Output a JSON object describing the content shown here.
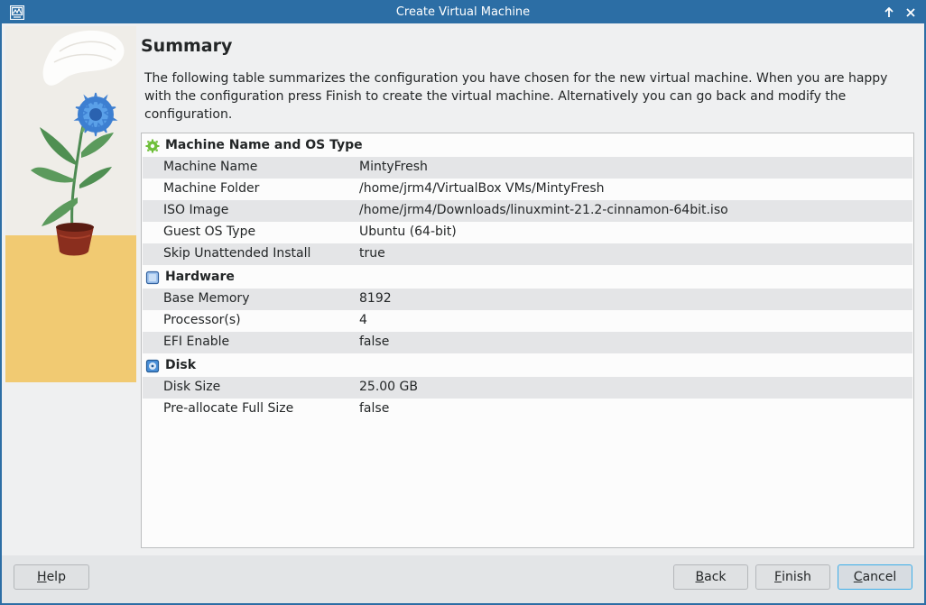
{
  "window": {
    "title": "Create Virtual Machine"
  },
  "page": {
    "heading": "Summary",
    "description": "The following table summarizes the configuration you have chosen for the new virtual machine. When you are happy with the configuration press Finish to create the virtual machine. Alternatively you can go back and modify the configuration."
  },
  "summary": {
    "groups": [
      {
        "title": "Machine Name and OS Type",
        "icon": "gear-cog-icon",
        "rows": [
          {
            "key": "Machine Name",
            "value": "MintyFresh"
          },
          {
            "key": "Machine Folder",
            "value": "/home/jrm4/VirtualBox VMs/MintyFresh"
          },
          {
            "key": "ISO Image",
            "value": "/home/jrm4/Downloads/linuxmint-21.2-cinnamon-64bit.iso"
          },
          {
            "key": "Guest OS Type",
            "value": "Ubuntu (64-bit)"
          },
          {
            "key": "Skip Unattended Install",
            "value": "true"
          }
        ]
      },
      {
        "title": "Hardware",
        "icon": "chip-icon",
        "rows": [
          {
            "key": "Base Memory",
            "value": "8192"
          },
          {
            "key": "Processor(s)",
            "value": "4"
          },
          {
            "key": "EFI Enable",
            "value": "false"
          }
        ]
      },
      {
        "title": "Disk",
        "icon": "disk-icon",
        "rows": [
          {
            "key": "Disk Size",
            "value": "25.00 GB"
          },
          {
            "key": "Pre-allocate Full Size",
            "value": "false"
          }
        ]
      }
    ]
  },
  "buttons": {
    "help": {
      "mnemonic": "H",
      "rest": "elp"
    },
    "back": {
      "mnemonic": "B",
      "rest": "ack"
    },
    "finish": {
      "mnemonic": "F",
      "rest": "inish"
    },
    "cancel": {
      "mnemonic": "C",
      "rest": "ancel"
    }
  },
  "colors": {
    "titlebar": "#2c6ea5",
    "focus": "#3daee9",
    "row_alt": "#e4e5e7"
  }
}
